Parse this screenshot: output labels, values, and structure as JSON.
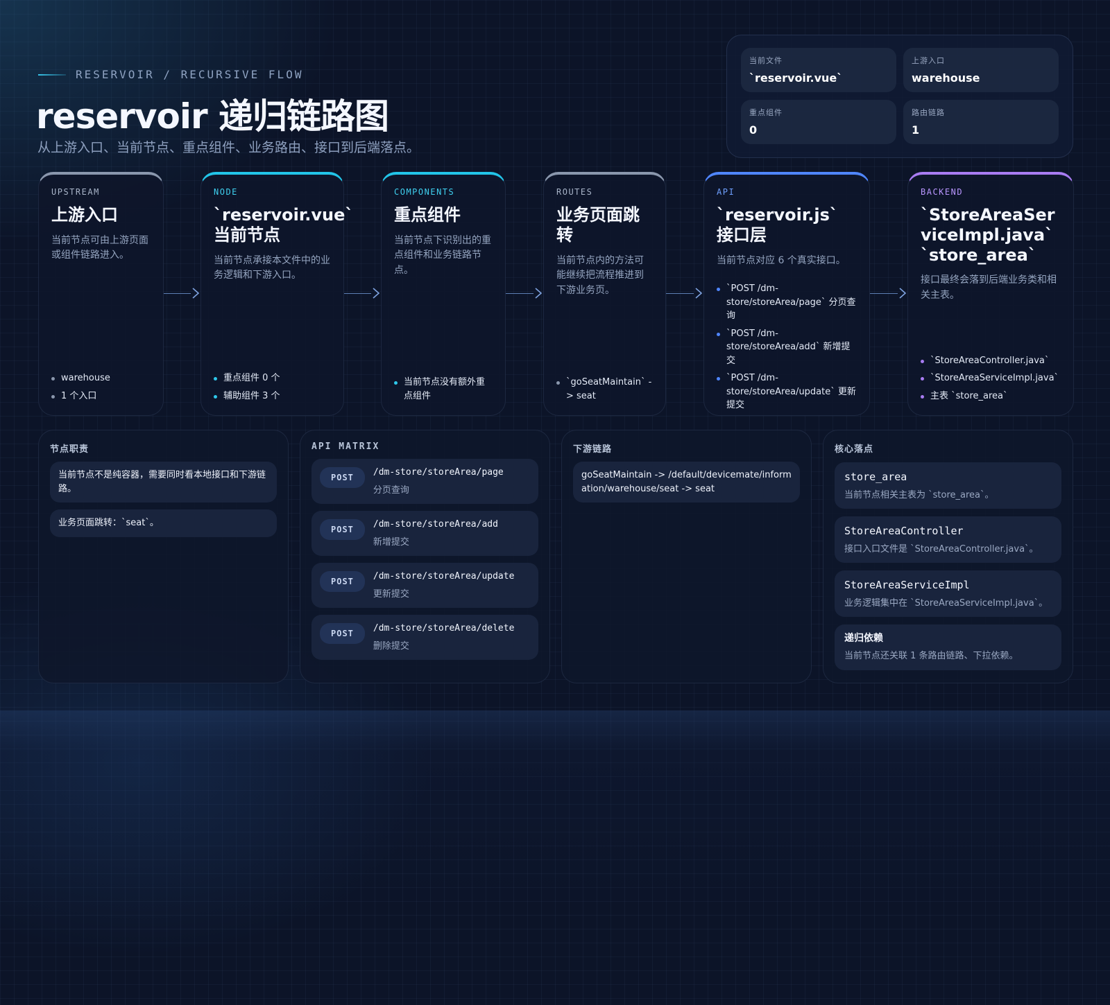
{
  "header": {
    "eyebrow": "RESERVOIR / RECURSIVE FLOW",
    "title": "reservoir 递归链路图",
    "subtitle": "从上游入口、当前节点、重点组件、业务路由、接口到后端落点。"
  },
  "stats": [
    {
      "label": "当前文件",
      "value": "`reservoir.vue`"
    },
    {
      "label": "上游入口",
      "value": "warehouse"
    },
    {
      "label": "重点组件",
      "value": "0"
    },
    {
      "label": "路由链路",
      "value": "1"
    }
  ],
  "flow": [
    {
      "tag": "UPSTREAM",
      "title": "上游入口",
      "desc": "当前节点可由上游页面或组件链路进入。",
      "items": [
        "warehouse",
        "1 个入口"
      ]
    },
    {
      "tag": "NODE",
      "title": "`reservoir.vue`\n当前节点",
      "desc": "当前节点承接本文件中的业务逻辑和下游入口。",
      "items": [
        "重点组件 0 个",
        "辅助组件 3 个"
      ]
    },
    {
      "tag": "COMPONENTS",
      "title": "重点组件",
      "desc": "当前节点下识别出的重点组件和业务链路节点。",
      "items": [
        "当前节点没有额外重点组件"
      ]
    },
    {
      "tag": "ROUTES",
      "title": "业务页面跳转",
      "desc": "当前节点内的方法可能继续把流程推进到下游业务页。",
      "items": [
        "`goSeatMaintain` -> seat"
      ]
    },
    {
      "tag": "API",
      "title": "`reservoir.js`\n接口层",
      "desc": "当前节点对应 6 个真实接口。",
      "items": [
        "`POST /dm-store/storeArea/page` 分页查询",
        "`POST /dm-store/storeArea/add` 新增提交",
        "`POST /dm-store/storeArea/update` 更新提交"
      ]
    },
    {
      "tag": "BACKEND",
      "title": "`StoreAreaServiceImpl.java`\n`store_area`",
      "desc": "接口最终会落到后端业务类和相关主表。",
      "items": [
        "`StoreAreaController.java`",
        "`StoreAreaServiceImpl.java`",
        "主表 `store_area`"
      ]
    }
  ],
  "panels": {
    "duty": {
      "title": "节点职责",
      "items": [
        "当前节点不是纯容器，需要同时看本地接口和下游链路。",
        "业务页面跳转：`seat`。"
      ]
    },
    "api": {
      "title": "API MATRIX",
      "items": [
        {
          "method": "POST",
          "path": "/dm-store/storeArea/page",
          "desc": "分页查询"
        },
        {
          "method": "POST",
          "path": "/dm-store/storeArea/add",
          "desc": "新增提交"
        },
        {
          "method": "POST",
          "path": "/dm-store/storeArea/update",
          "desc": "更新提交"
        },
        {
          "method": "POST",
          "path": "/dm-store/storeArea/delete",
          "desc": "删除提交"
        }
      ]
    },
    "downstream": {
      "title": "下游链路",
      "items": [
        "goSeatMaintain -> /default/devicemate/information/warehouse/seat -> seat"
      ]
    },
    "core": {
      "title": "核心落点",
      "items": [
        {
          "name": "store_area",
          "desc": "当前节点相关主表为 `store_area`。"
        },
        {
          "name": "StoreAreaController",
          "desc": "接口入口文件是 `StoreAreaController.java`。"
        },
        {
          "name": "StoreAreaServiceImpl",
          "desc": "业务逻辑集中在 `StoreAreaServiceImpl.java`。"
        },
        {
          "name": "递归依赖",
          "desc": "当前节点还关联 1 条路由链路、下拉依赖。"
        }
      ]
    }
  },
  "colors": {
    "background": "#0c1428",
    "cyan": "#22c4e8",
    "blue": "#4f86ff",
    "purple": "#a87cf2",
    "gray": "#8a97ad"
  }
}
